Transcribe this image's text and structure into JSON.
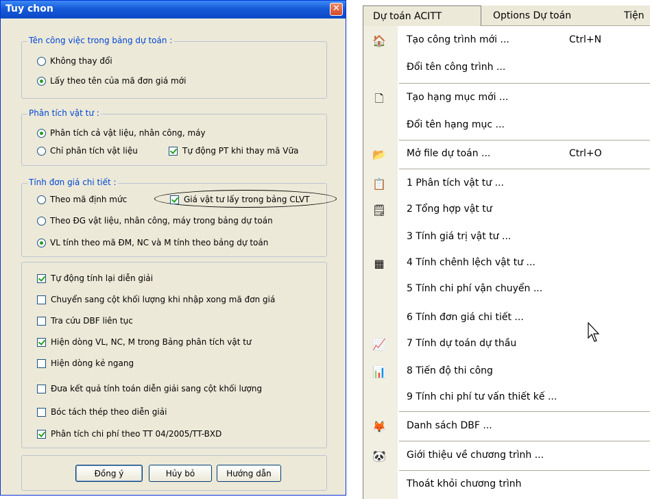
{
  "dialog": {
    "title": "Tuy chon",
    "group1": {
      "title": "Tên công việc trong bảng dự toán :",
      "options": [
        "Không thay đổi",
        "Lấy theo tên của mã đơn giá mới"
      ]
    },
    "group2": {
      "title": "Phân tích vật tư :",
      "opt1": "Phân tích cả vật liệu, nhân công, máy",
      "opt2": "Chỉ phân tích vật liệu",
      "check": "Tự động PT khi thay mã Vữa"
    },
    "group3": {
      "title": "Tính đơn giá chi tiết :",
      "opt1": "Theo mã định mức",
      "check": "Giá vật tư lấy trong bảng CLVT",
      "opt2": "Theo ĐG vật liệu, nhân công, máy trong bảng dự toán",
      "opt3": "VL tính theo mã ĐM, NC và M tính theo bảng dự toán"
    },
    "checks": [
      "Tự động tính lại diễn giải",
      "Chuyển sang cột khối lượng khi nhập xong mã đơn giá",
      "Tra cứu DBF liên tục",
      "Hiện dòng VL, NC, M trong Bảng phân tích vật tư",
      "Hiện dòng kẻ ngang",
      "Đưa kết quả tính toán diễn giải sang cột khối lượng",
      "Bóc tách thép theo diễn giải",
      "Phân tích chi phí theo TT 04/2005/TT-BXD"
    ],
    "buttons": {
      "ok": "Đồng ý",
      "cancel": "Hủy bỏ",
      "help": "Hướng dẫn"
    }
  },
  "menubar": {
    "items": [
      "Dự toán ACITT",
      "Options Dự toán",
      "Tiện"
    ]
  },
  "menu": {
    "items": [
      {
        "label": "Tạo công trình mới ...",
        "shortcut": "Ctrl+N"
      },
      {
        "label": "Đổi tên công trình ..."
      },
      {
        "label": "Tạo hạng mục mới ..."
      },
      {
        "label": "Đổi tên hạng mục ..."
      },
      {
        "label": "Mở file dự toán ...",
        "shortcut": "Ctrl+O"
      },
      {
        "label": "1 Phân tích vật tư ..."
      },
      {
        "label": "2 Tổng hợp vật tư"
      },
      {
        "label": "3 Tính giá trị vật tư ..."
      },
      {
        "label": "4 Tính chênh lệch vật tư ..."
      },
      {
        "label": "5 Tính chi phí vận chuyển ..."
      },
      {
        "label": "6 Tính đơn giá chi tiết ..."
      },
      {
        "label": "7 Tính dự toán dự thầu"
      },
      {
        "label": "8 Tiến độ thi công"
      },
      {
        "label": "9 Tính chi phí tư vấn thiết kế ..."
      },
      {
        "label": "Danh sách DBF ..."
      },
      {
        "label": "Giới thiệu về chương trình ..."
      },
      {
        "label": "Thoát khỏi chương trình"
      }
    ]
  }
}
